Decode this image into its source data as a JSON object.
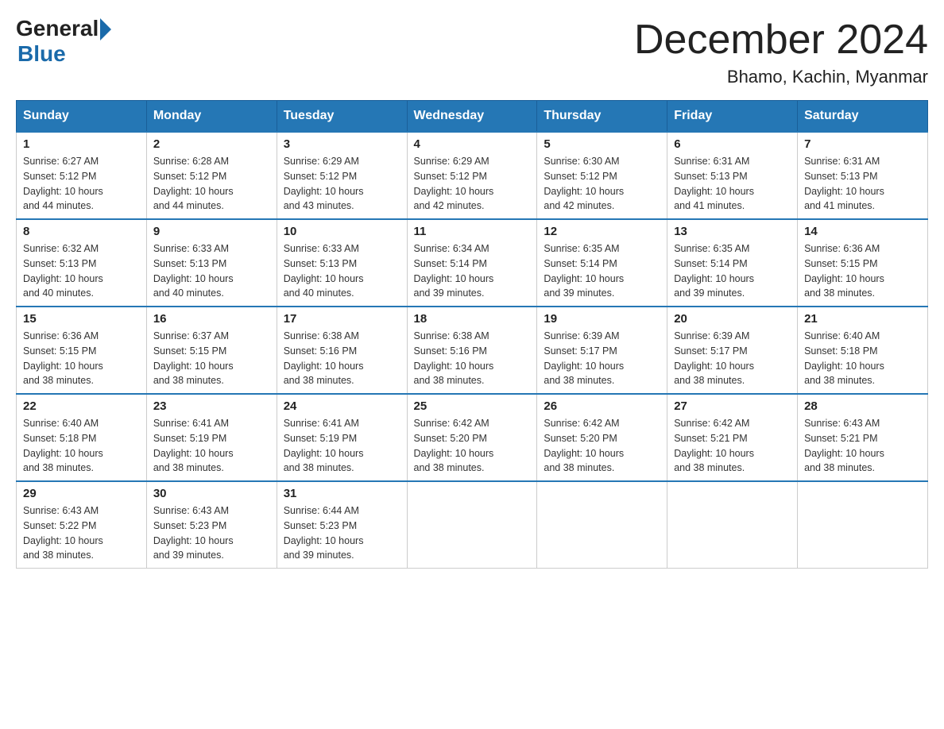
{
  "logo": {
    "general": "General",
    "blue": "Blue"
  },
  "title": {
    "month_year": "December 2024",
    "location": "Bhamo, Kachin, Myanmar"
  },
  "days_of_week": [
    "Sunday",
    "Monday",
    "Tuesday",
    "Wednesday",
    "Thursday",
    "Friday",
    "Saturday"
  ],
  "weeks": [
    [
      {
        "day": "1",
        "sunrise": "6:27 AM",
        "sunset": "5:12 PM",
        "daylight": "10 hours and 44 minutes."
      },
      {
        "day": "2",
        "sunrise": "6:28 AM",
        "sunset": "5:12 PM",
        "daylight": "10 hours and 44 minutes."
      },
      {
        "day": "3",
        "sunrise": "6:29 AM",
        "sunset": "5:12 PM",
        "daylight": "10 hours and 43 minutes."
      },
      {
        "day": "4",
        "sunrise": "6:29 AM",
        "sunset": "5:12 PM",
        "daylight": "10 hours and 42 minutes."
      },
      {
        "day": "5",
        "sunrise": "6:30 AM",
        "sunset": "5:12 PM",
        "daylight": "10 hours and 42 minutes."
      },
      {
        "day": "6",
        "sunrise": "6:31 AM",
        "sunset": "5:13 PM",
        "daylight": "10 hours and 41 minutes."
      },
      {
        "day": "7",
        "sunrise": "6:31 AM",
        "sunset": "5:13 PM",
        "daylight": "10 hours and 41 minutes."
      }
    ],
    [
      {
        "day": "8",
        "sunrise": "6:32 AM",
        "sunset": "5:13 PM",
        "daylight": "10 hours and 40 minutes."
      },
      {
        "day": "9",
        "sunrise": "6:33 AM",
        "sunset": "5:13 PM",
        "daylight": "10 hours and 40 minutes."
      },
      {
        "day": "10",
        "sunrise": "6:33 AM",
        "sunset": "5:13 PM",
        "daylight": "10 hours and 40 minutes."
      },
      {
        "day": "11",
        "sunrise": "6:34 AM",
        "sunset": "5:14 PM",
        "daylight": "10 hours and 39 minutes."
      },
      {
        "day": "12",
        "sunrise": "6:35 AM",
        "sunset": "5:14 PM",
        "daylight": "10 hours and 39 minutes."
      },
      {
        "day": "13",
        "sunrise": "6:35 AM",
        "sunset": "5:14 PM",
        "daylight": "10 hours and 39 minutes."
      },
      {
        "day": "14",
        "sunrise": "6:36 AM",
        "sunset": "5:15 PM",
        "daylight": "10 hours and 38 minutes."
      }
    ],
    [
      {
        "day": "15",
        "sunrise": "6:36 AM",
        "sunset": "5:15 PM",
        "daylight": "10 hours and 38 minutes."
      },
      {
        "day": "16",
        "sunrise": "6:37 AM",
        "sunset": "5:15 PM",
        "daylight": "10 hours and 38 minutes."
      },
      {
        "day": "17",
        "sunrise": "6:38 AM",
        "sunset": "5:16 PM",
        "daylight": "10 hours and 38 minutes."
      },
      {
        "day": "18",
        "sunrise": "6:38 AM",
        "sunset": "5:16 PM",
        "daylight": "10 hours and 38 minutes."
      },
      {
        "day": "19",
        "sunrise": "6:39 AM",
        "sunset": "5:17 PM",
        "daylight": "10 hours and 38 minutes."
      },
      {
        "day": "20",
        "sunrise": "6:39 AM",
        "sunset": "5:17 PM",
        "daylight": "10 hours and 38 minutes."
      },
      {
        "day": "21",
        "sunrise": "6:40 AM",
        "sunset": "5:18 PM",
        "daylight": "10 hours and 38 minutes."
      }
    ],
    [
      {
        "day": "22",
        "sunrise": "6:40 AM",
        "sunset": "5:18 PM",
        "daylight": "10 hours and 38 minutes."
      },
      {
        "day": "23",
        "sunrise": "6:41 AM",
        "sunset": "5:19 PM",
        "daylight": "10 hours and 38 minutes."
      },
      {
        "day": "24",
        "sunrise": "6:41 AM",
        "sunset": "5:19 PM",
        "daylight": "10 hours and 38 minutes."
      },
      {
        "day": "25",
        "sunrise": "6:42 AM",
        "sunset": "5:20 PM",
        "daylight": "10 hours and 38 minutes."
      },
      {
        "day": "26",
        "sunrise": "6:42 AM",
        "sunset": "5:20 PM",
        "daylight": "10 hours and 38 minutes."
      },
      {
        "day": "27",
        "sunrise": "6:42 AM",
        "sunset": "5:21 PM",
        "daylight": "10 hours and 38 minutes."
      },
      {
        "day": "28",
        "sunrise": "6:43 AM",
        "sunset": "5:21 PM",
        "daylight": "10 hours and 38 minutes."
      }
    ],
    [
      {
        "day": "29",
        "sunrise": "6:43 AM",
        "sunset": "5:22 PM",
        "daylight": "10 hours and 38 minutes."
      },
      {
        "day": "30",
        "sunrise": "6:43 AM",
        "sunset": "5:23 PM",
        "daylight": "10 hours and 39 minutes."
      },
      {
        "day": "31",
        "sunrise": "6:44 AM",
        "sunset": "5:23 PM",
        "daylight": "10 hours and 39 minutes."
      },
      null,
      null,
      null,
      null
    ]
  ],
  "labels": {
    "sunrise": "Sunrise:",
    "sunset": "Sunset:",
    "daylight": "Daylight:"
  }
}
